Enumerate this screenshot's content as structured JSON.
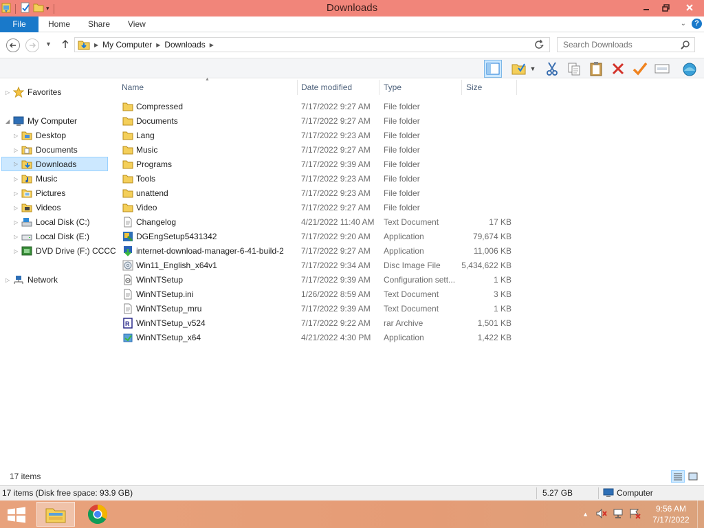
{
  "window": {
    "title": "Downloads"
  },
  "ribbon": {
    "tabs": {
      "file": "File",
      "home": "Home",
      "share": "Share",
      "view": "View"
    }
  },
  "address": {
    "segments": [
      "My Computer",
      "Downloads"
    ]
  },
  "search": {
    "placeholder": "Search Downloads"
  },
  "nav": {
    "favorites": "Favorites",
    "my_computer": "My Computer",
    "children": [
      "Desktop",
      "Documents",
      "Downloads",
      "Music",
      "Pictures",
      "Videos",
      "Local Disk (C:)",
      "Local Disk (E:)",
      "DVD Drive (F:) CCCC"
    ],
    "network": "Network",
    "selected": "Downloads"
  },
  "columns": {
    "name": "Name",
    "date": "Date modified",
    "type": "Type",
    "size": "Size"
  },
  "files": [
    {
      "name": "Compressed",
      "date": "7/17/2022 9:27 AM",
      "type": "File folder",
      "size": "",
      "icon": "folder-icon"
    },
    {
      "name": "Documents",
      "date": "7/17/2022 9:27 AM",
      "type": "File folder",
      "size": "",
      "icon": "folder-icon"
    },
    {
      "name": "Lang",
      "date": "7/17/2022 9:23 AM",
      "type": "File folder",
      "size": "",
      "icon": "folder-icon"
    },
    {
      "name": "Music",
      "date": "7/17/2022 9:27 AM",
      "type": "File folder",
      "size": "",
      "icon": "folder-icon"
    },
    {
      "name": "Programs",
      "date": "7/17/2022 9:39 AM",
      "type": "File folder",
      "size": "",
      "icon": "folder-icon"
    },
    {
      "name": "Tools",
      "date": "7/17/2022 9:23 AM",
      "type": "File folder",
      "size": "",
      "icon": "folder-icon"
    },
    {
      "name": "unattend",
      "date": "7/17/2022 9:23 AM",
      "type": "File folder",
      "size": "",
      "icon": "folder-icon"
    },
    {
      "name": "Video",
      "date": "7/17/2022 9:27 AM",
      "type": "File folder",
      "size": "",
      "icon": "folder-icon"
    },
    {
      "name": "Changelog",
      "date": "4/21/2022 11:40 AM",
      "type": "Text Document",
      "size": "17 KB",
      "icon": "text-document-icon"
    },
    {
      "name": "DGEngSetup5431342",
      "date": "7/17/2022 9:20 AM",
      "type": "Application",
      "size": "79,674 KB",
      "icon": "setup-app-icon"
    },
    {
      "name": "internet-download-manager-6-41-build-2",
      "date": "7/17/2022 9:27 AM",
      "type": "Application",
      "size": "11,006 KB",
      "icon": "idm-app-icon"
    },
    {
      "name": "Win11_English_x64v1",
      "date": "7/17/2022 9:34 AM",
      "type": "Disc Image File",
      "size": "5,434,622 KB",
      "icon": "disc-image-icon"
    },
    {
      "name": "WinNTSetup",
      "date": "7/17/2022 9:39 AM",
      "type": "Configuration sett...",
      "size": "1 KB",
      "icon": "config-file-icon"
    },
    {
      "name": "WinNTSetup.ini",
      "date": "1/26/2022 8:59 AM",
      "type": "Text Document",
      "size": "3 KB",
      "icon": "text-document-icon"
    },
    {
      "name": "WinNTSetup_mru",
      "date": "7/17/2022 9:39 AM",
      "type": "Text Document",
      "size": "1 KB",
      "icon": "text-document-icon"
    },
    {
      "name": "WinNTSetup_v524",
      "date": "7/17/2022 9:22 AM",
      "type": "rar Archive",
      "size": "1,501 KB",
      "icon": "rar-archive-icon"
    },
    {
      "name": "WinNTSetup_x64",
      "date": "4/21/2022 4:30 PM",
      "type": "Application",
      "size": "1,422 KB",
      "icon": "app-icon"
    }
  ],
  "status": {
    "item_count": "17 items",
    "disk_info": "17 items (Disk free space: 93.9 GB)",
    "size_total": "5.27 GB",
    "location": "Computer"
  },
  "taskbar": {
    "time": "9:56 AM",
    "date": "7/17/2022"
  },
  "colors": {
    "title_bar": "#f1857a",
    "file_tab": "#1979ca",
    "selection": "#cce8ff",
    "taskbar": "#e59c76"
  }
}
